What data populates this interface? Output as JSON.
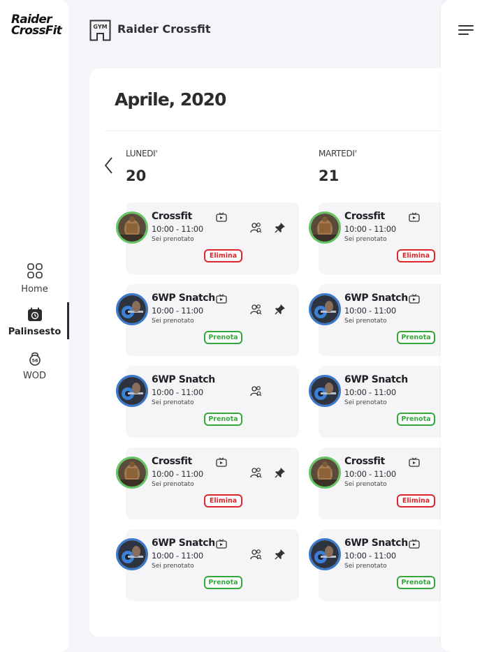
{
  "sidebar": {
    "logo_line1": "Raider",
    "logo_line2": "CrossFit",
    "items": [
      {
        "label": "Home",
        "icon": "grid-icon"
      },
      {
        "label": "Palinsesto",
        "icon": "calendar-clock-icon",
        "active": true
      },
      {
        "label": "WOD",
        "icon": "kettlebell-icon"
      }
    ]
  },
  "header": {
    "gym_badge": "GYM",
    "title": "Raider Crossfit"
  },
  "schedule": {
    "month_title": "Aprile, 2020",
    "days": [
      {
        "name": "LUNEDI'",
        "number": "20",
        "classes": [
          {
            "title": "Crossfit",
            "time": "10:00 - 11:00",
            "status": "Sei prenotato",
            "button": "Elimina",
            "button_color": "#e0262b",
            "avatar": "crossfit",
            "tv": true,
            "people": true,
            "pin": true
          },
          {
            "title": "6WP Snatch",
            "time": "10:00 - 11:00",
            "status": "Sei prenotato",
            "button": "Prenota",
            "button_color": "#35a83a",
            "avatar": "snatch",
            "tv": true,
            "people": true,
            "pin": true
          },
          {
            "title": "6WP Snatch",
            "time": "10:00 - 11:00",
            "status": "Sei prenotato",
            "button": "Prenota",
            "button_color": "#35a83a",
            "avatar": "snatch",
            "tv": false,
            "people": true,
            "pin": false
          },
          {
            "title": "Crossfit",
            "time": "10:00 - 11:00",
            "status": "Sei prenotato",
            "button": "Elimina",
            "button_color": "#e0262b",
            "avatar": "crossfit",
            "tv": true,
            "people": true,
            "pin": true
          },
          {
            "title": "6WP Snatch",
            "time": "10:00 - 11:00",
            "status": "Sei prenotato",
            "button": "Prenota",
            "button_color": "#35a83a",
            "avatar": "snatch",
            "tv": true,
            "people": true,
            "pin": true
          }
        ]
      },
      {
        "name": "MARTEDI'",
        "number": "21",
        "classes": [
          {
            "title": "Crossfit",
            "time": "10:00 - 11:00",
            "status": "Sei prenotato",
            "button": "Elimina",
            "button_color": "#e0262b",
            "avatar": "crossfit",
            "tv": true,
            "people": false,
            "pin": false
          },
          {
            "title": "6WP Snatch",
            "time": "10:00 - 11:00",
            "status": "Sei prenotato",
            "button": "Prenota",
            "button_color": "#35a83a",
            "avatar": "snatch",
            "tv": true,
            "people": false,
            "pin": false
          },
          {
            "title": "6WP Snatch",
            "time": "10:00 - 11:00",
            "status": "Sei prenotato",
            "button": "Prenota",
            "button_color": "#35a83a",
            "avatar": "snatch",
            "tv": false,
            "people": false,
            "pin": false
          },
          {
            "title": "Crossfit",
            "time": "10:00 - 11:00",
            "status": "Sei prenotato",
            "button": "Elimina",
            "button_color": "#e0262b",
            "avatar": "crossfit",
            "tv": true,
            "people": false,
            "pin": false
          },
          {
            "title": "6WP Snatch",
            "time": "10:00 - 11:00",
            "status": "Sei prenotato",
            "button": "Prenota",
            "button_color": "#35a83a",
            "avatar": "snatch",
            "tv": true,
            "people": false,
            "pin": false
          }
        ]
      }
    ]
  },
  "right_panel": {
    "menu_icon": "hamburger-menu-icon"
  }
}
